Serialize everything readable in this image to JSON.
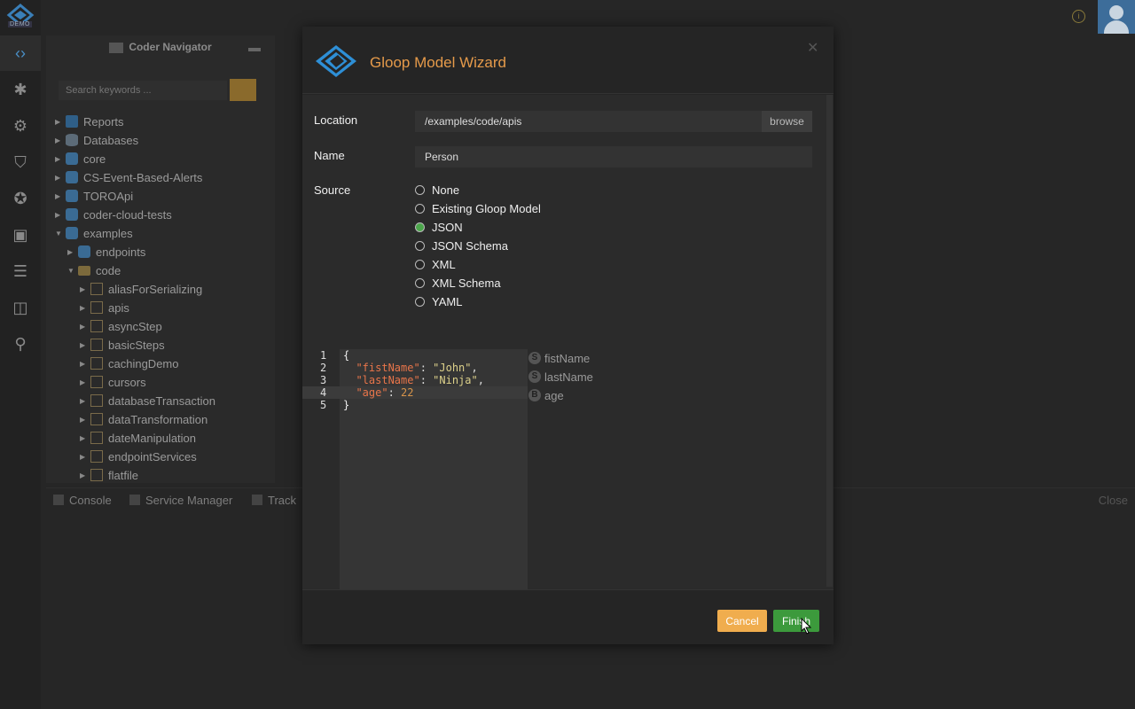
{
  "app": {
    "logo_badge": "DEMO",
    "rail_icons": [
      "code-icon",
      "bug-icon",
      "services-icon",
      "shield-icon",
      "gauge-icon",
      "terminal-icon",
      "doc-icon",
      "monitor-icon",
      "search-icon"
    ]
  },
  "navigator": {
    "title": "Coder Navigator",
    "search_placeholder": "Search keywords ...",
    "tree": [
      {
        "label": "Reports",
        "icon": "report",
        "depth": 0,
        "open": false
      },
      {
        "label": "Databases",
        "icon": "db",
        "depth": 0,
        "open": false
      },
      {
        "label": "core",
        "icon": "pkg",
        "depth": 0,
        "open": false
      },
      {
        "label": "CS-Event-Based-Alerts",
        "icon": "pkg",
        "depth": 0,
        "open": false
      },
      {
        "label": "TOROApi",
        "icon": "pkg",
        "depth": 0,
        "open": false
      },
      {
        "label": "coder-cloud-tests",
        "icon": "pkg",
        "depth": 0,
        "open": false
      },
      {
        "label": "examples",
        "icon": "pkg",
        "depth": 0,
        "open": true
      },
      {
        "label": "endpoints",
        "icon": "pkg",
        "depth": 1,
        "open": false
      },
      {
        "label": "code",
        "icon": "folder",
        "depth": 1,
        "open": true
      },
      {
        "label": "aliasForSerializing",
        "icon": "grid",
        "depth": 2,
        "open": false
      },
      {
        "label": "apis",
        "icon": "grid",
        "depth": 2,
        "open": false
      },
      {
        "label": "asyncStep",
        "icon": "grid",
        "depth": 2,
        "open": false
      },
      {
        "label": "basicSteps",
        "icon": "grid",
        "depth": 2,
        "open": false
      },
      {
        "label": "cachingDemo",
        "icon": "grid",
        "depth": 2,
        "open": false
      },
      {
        "label": "cursors",
        "icon": "grid",
        "depth": 2,
        "open": false
      },
      {
        "label": "databaseTransaction",
        "icon": "grid",
        "depth": 2,
        "open": false
      },
      {
        "label": "dataTransformation",
        "icon": "grid",
        "depth": 2,
        "open": false
      },
      {
        "label": "dateManipulation",
        "icon": "grid",
        "depth": 2,
        "open": false
      },
      {
        "label": "endpointServices",
        "icon": "grid",
        "depth": 2,
        "open": false
      },
      {
        "label": "flatfile",
        "icon": "grid",
        "depth": 2,
        "open": false
      }
    ]
  },
  "bottom_tabs": {
    "console": "Console",
    "service_manager": "Service Manager",
    "tracker": "Track",
    "close": "Close"
  },
  "wizard": {
    "title": "Gloop Model Wizard",
    "location_label": "Location",
    "location_value": "/examples/code/apis",
    "browse_label": "browse",
    "name_label": "Name",
    "name_value": "Person",
    "source_label": "Source",
    "source_options": [
      "None",
      "Existing Gloop Model",
      "JSON",
      "JSON Schema",
      "XML",
      "XML Schema",
      "YAML"
    ],
    "source_selected": "JSON",
    "editor_lines": [
      "1",
      "2",
      "3",
      "4",
      "5"
    ],
    "code": {
      "open": "{",
      "k1": "\"fistName\"",
      "v1": "\"John\"",
      "k2": "\"lastName\"",
      "v2": "\"Ninja\"",
      "k3": "\"age\"",
      "v3": "22",
      "close": "}"
    },
    "model_fields": [
      {
        "badge": "S",
        "name": "fistName"
      },
      {
        "badge": "S",
        "name": "lastName"
      },
      {
        "badge": "B",
        "name": "age"
      }
    ],
    "cancel_label": "Cancel",
    "finish_label": "Finish"
  }
}
